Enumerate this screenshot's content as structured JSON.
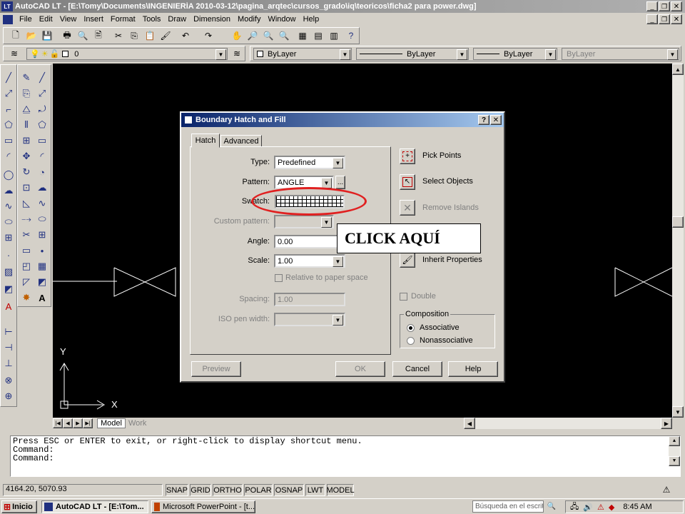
{
  "window": {
    "title": "AutoCAD LT - [E:\\Tomy\\Documents\\INGENIERÍA 2010-03-12\\pagina_arqtec\\cursos_grado\\iq\\teoricos\\ficha2 para power.dwg]"
  },
  "menu": [
    "File",
    "Edit",
    "View",
    "Insert",
    "Format",
    "Tools",
    "Draw",
    "Dimension",
    "Modify",
    "Window",
    "Help"
  ],
  "layers": {
    "current_layer": "0",
    "color": "ByLayer",
    "linetype": "ByLayer",
    "lineweight": "ByLayer",
    "plotstyle": "ByLayer"
  },
  "layout_tabs": [
    "Model",
    "Work"
  ],
  "dialog": {
    "title": "Boundary Hatch and Fill",
    "tabs": [
      "Hatch",
      "Advanced"
    ],
    "type_label": "Type:",
    "type_value": "Predefined",
    "pattern_label": "Pattern:",
    "pattern_value": "ANGLE",
    "pattern_more": "...",
    "swatch_label": "Swatch:",
    "custom_label": "Custom pattern:",
    "angle_label": "Angle:",
    "angle_value": "0.00",
    "scale_label": "Scale:",
    "scale_value": "1.00",
    "relative_label": "Relative to paper space",
    "spacing_label": "Spacing:",
    "spacing_value": "1.00",
    "iso_label": "ISO pen width:",
    "pick_points": "Pick Points",
    "select_objects": "Select Objects",
    "remove_islands": "Remove Islands",
    "inherit": "Inherit Properties",
    "double": "Double",
    "composition": "Composition",
    "associative": "Associative",
    "nonassociative": "Nonassociative",
    "preview": "Preview",
    "ok": "OK",
    "cancel": "Cancel",
    "help": "Help"
  },
  "annotation": "CLICK AQUÍ",
  "command_lines": [
    "Press ESC or ENTER to exit, or right-click to display shortcut menu.",
    "Command:",
    "Command:"
  ],
  "status": {
    "coords": "4164.20, 5070.93",
    "toggles": [
      "SNAP",
      "GRID",
      "ORTHO",
      "POLAR",
      "OSNAP",
      "LWT",
      "MODEL"
    ]
  },
  "taskbar": {
    "start": "Inicio",
    "tasks": [
      "AutoCAD LT - [E:\\Tom...",
      "Microsoft PowerPoint - [t..."
    ],
    "search_placeholder": "Búsqueda en el escrit",
    "clock": "8:45 AM"
  },
  "axis": {
    "x": "X",
    "y": "Y"
  }
}
